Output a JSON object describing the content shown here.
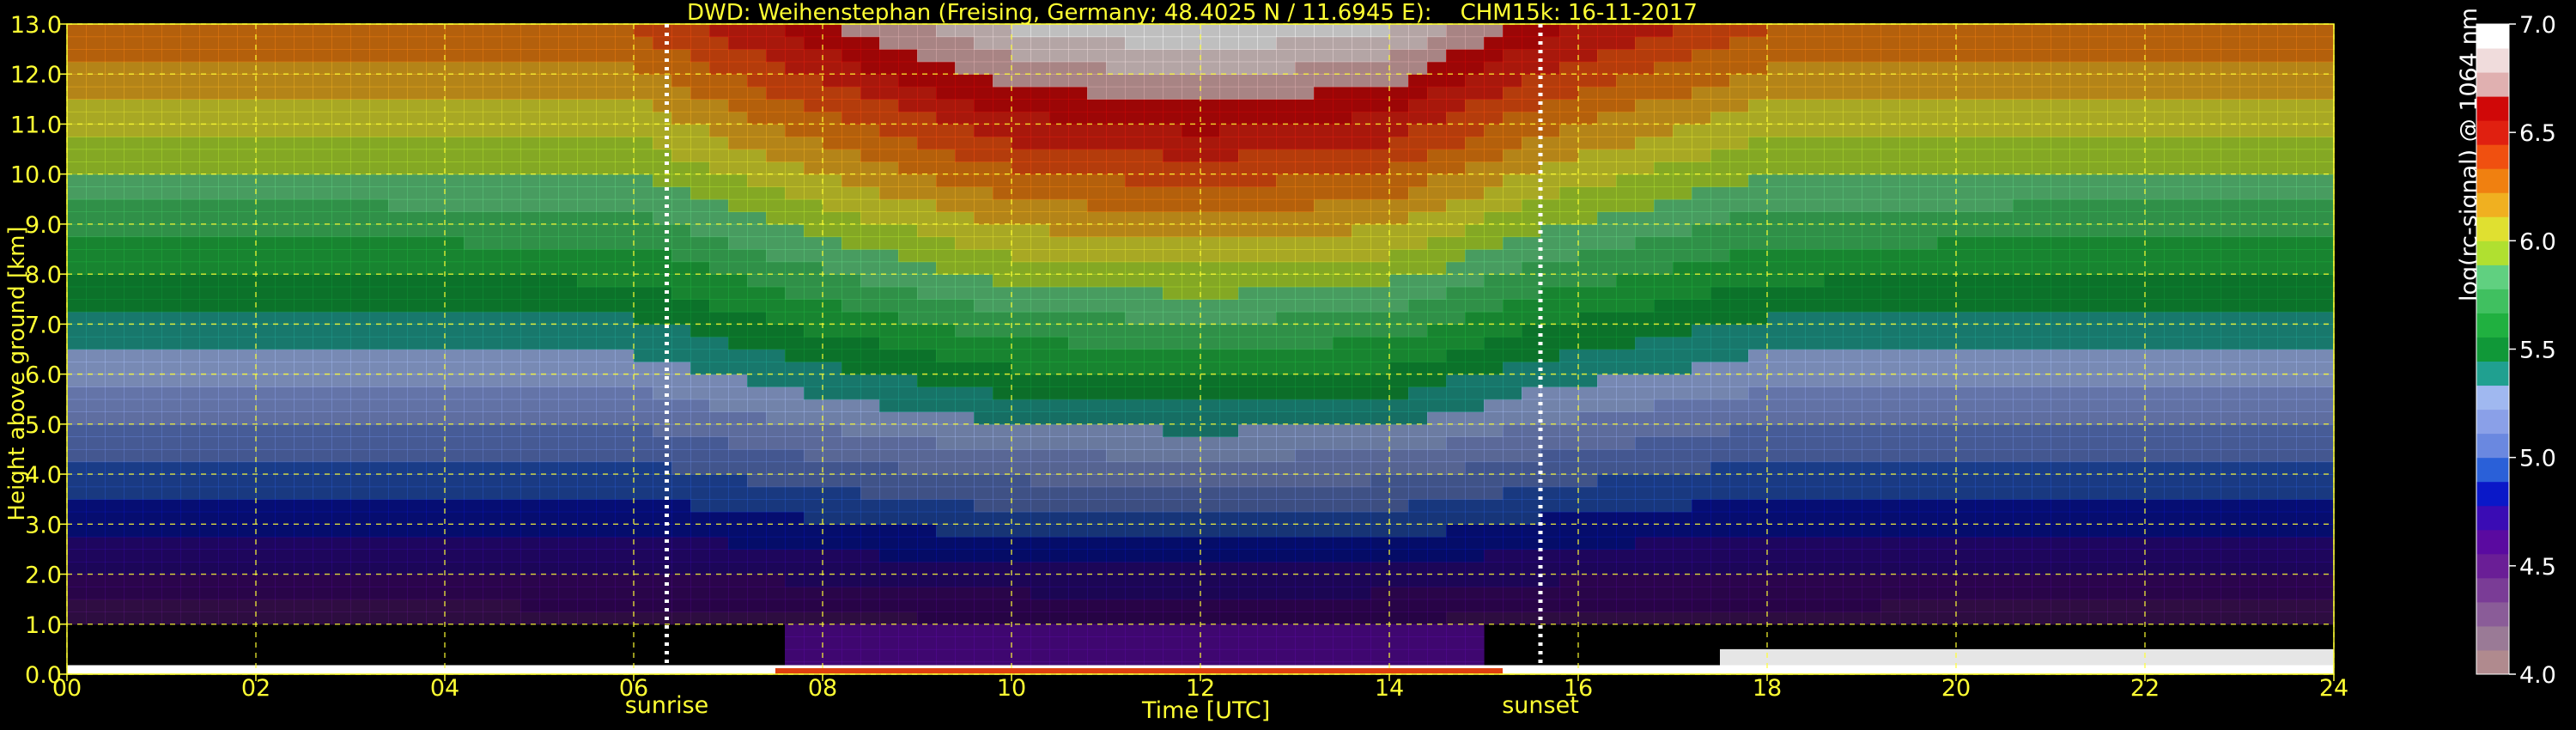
{
  "chart_data": {
    "type": "heatmap",
    "title": "DWD: Weihenstephan (Freising, Germany; 48.4025 N / 11.6945 E):    CHM15k: 16-11-2017",
    "xlabel": "Time [UTC]",
    "ylabel": "Height above ground [km]",
    "colorbar_label": "log(rc-signal) @ 1064 nm",
    "xlim": [
      0,
      24
    ],
    "ylim": [
      0,
      13
    ],
    "x_ticks": [
      "00",
      "02",
      "04",
      "06",
      "08",
      "10",
      "12",
      "14",
      "16",
      "18",
      "20",
      "22",
      "24"
    ],
    "x_tick_values": [
      0,
      2,
      4,
      6,
      8,
      10,
      12,
      14,
      16,
      18,
      20,
      22,
      24
    ],
    "y_ticks": [
      "0.0",
      "1.0",
      "2.0",
      "3.0",
      "4.0",
      "5.0",
      "6.0",
      "7.0",
      "8.0",
      "9.0",
      "10.0",
      "11.0",
      "12.0",
      "13.0"
    ],
    "y_tick_values": [
      0,
      1,
      2,
      3,
      4,
      5,
      6,
      7,
      8,
      9,
      10,
      11,
      12,
      13
    ],
    "grid": true,
    "events": [
      {
        "label": "sunrise",
        "time": 6.35
      },
      {
        "label": "sunset",
        "time": 15.6
      }
    ],
    "colorbar": {
      "range": [
        4.0,
        7.0
      ],
      "ticks": [
        "4.0",
        "4.5",
        "5.0",
        "5.5",
        "6.0",
        "6.5",
        "7.0"
      ],
      "tick_values": [
        4.0,
        4.5,
        5.0,
        5.5,
        6.0,
        6.5,
        7.0
      ],
      "colors": [
        "#b08a8e",
        "#9a7a96",
        "#8a5c98",
        "#7a3c96",
        "#6a1e96",
        "#5a0aa0",
        "#3a0cb4",
        "#0a18c8",
        "#2a60d8",
        "#6a88e0",
        "#8aa0e8",
        "#a0b8f0",
        "#20a090",
        "#109838",
        "#20b040",
        "#40c060",
        "#60d080",
        "#b0e030",
        "#e0e030",
        "#f0b020",
        "#f08010",
        "#f05010",
        "#e02010",
        "#d00808",
        "#e0b0b0",
        "#f0dcdc",
        "#ffffff"
      ]
    },
    "profile": {
      "time_nodes": [
        0,
        3,
        6,
        8,
        10,
        12,
        14,
        15.6,
        18,
        21,
        24
      ],
      "brightness": [
        0.18,
        0.18,
        0.2,
        0.55,
        0.85,
        0.95,
        0.85,
        0.5,
        0.2,
        0.18,
        0.18
      ]
    }
  }
}
